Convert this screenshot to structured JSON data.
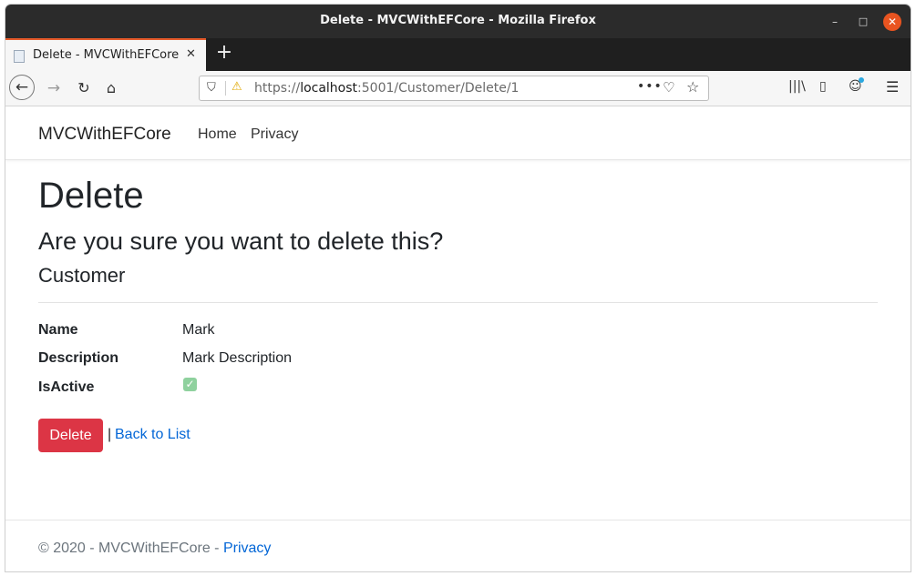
{
  "window": {
    "title": "Delete - MVCWithEFCore - Mozilla Firefox",
    "minimize_glyph": "–",
    "maximize_glyph": "□",
    "close_glyph": "✕"
  },
  "tab": {
    "title": "Delete - MVCWithEFCore",
    "close_glyph": "✕",
    "new_tab_glyph": "+"
  },
  "toolbar": {
    "back_icon": "←",
    "forward_icon": "→",
    "reload_icon": "↻",
    "home_icon": "⌂",
    "url_prefix": "https://",
    "url_host": "localhost",
    "url_rest": ":5001/Customer/Delete/1",
    "shield_icon": "⛉",
    "lock_icon": "⚠",
    "page_actions_icon": "•••",
    "pocket_icon": "♡",
    "star_icon": "☆",
    "library_icon": "|||\\",
    "sidebar_icon": "▯",
    "account_icon": "☺",
    "menu_icon": "☰"
  },
  "site": {
    "brand": "MVCWithEFCore",
    "nav": [
      {
        "label": "Home"
      },
      {
        "label": "Privacy"
      }
    ]
  },
  "main": {
    "heading": "Delete",
    "confirm_text": "Are you sure you want to delete this?",
    "entity": "Customer",
    "fields": [
      {
        "label": "Name",
        "value": "Mark"
      },
      {
        "label": "Description",
        "value": "Mark Description"
      },
      {
        "label": "IsActive",
        "value": true
      }
    ],
    "delete_label": "Delete",
    "separator": "|",
    "back_label": "Back to List"
  },
  "footer": {
    "copyright": "© 2020 - MVCWithEFCore - ",
    "privacy_link": "Privacy"
  },
  "colors": {
    "danger": "#dc3545",
    "link": "#0366d6",
    "tab_accent": "#e55b2b",
    "close_button": "#e95420",
    "checkbox": "#8fd19e"
  }
}
